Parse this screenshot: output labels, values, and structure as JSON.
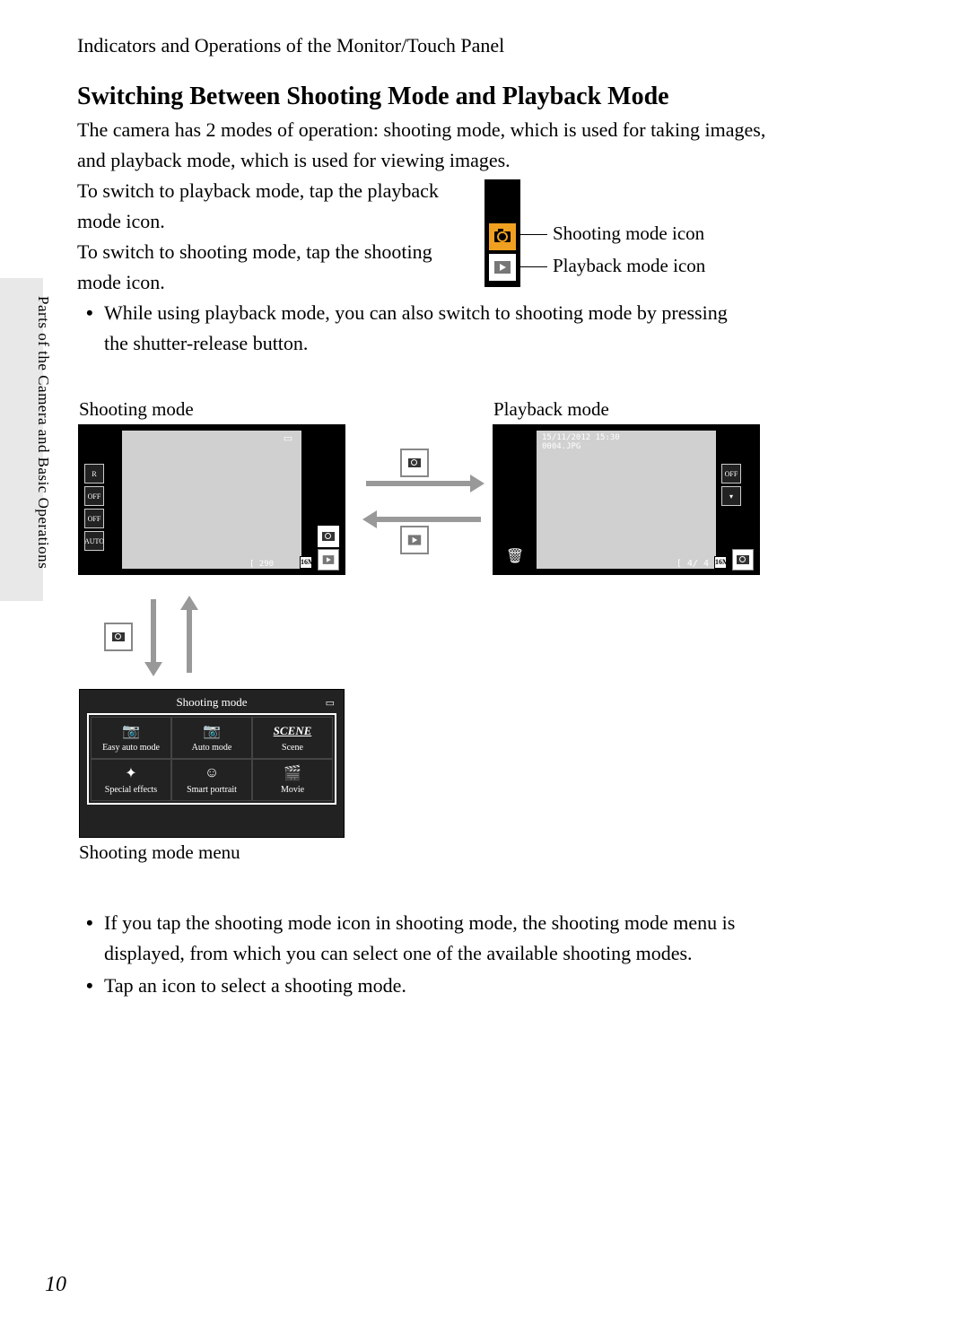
{
  "header": "Indicators and Operations of the Monitor/Touch Panel",
  "side_label": "Parts of the Camera and Basic Operations",
  "title": "Switching Between Shooting Mode and Playback Mode",
  "para1": "The camera has 2 modes of operation: shooting mode, which is used for taking images, and playback mode, which is used for viewing images.",
  "para2": "To switch to playback mode, tap the playback mode icon.",
  "para3": "To switch to shooting mode, tap the shooting mode icon.",
  "bullet1": "While using playback mode, you can also switch to shooting mode by pressing the shutter-release button.",
  "callout": {
    "shooting": "Shooting mode icon",
    "playback": "Playback mode icon"
  },
  "labels": {
    "shooting_mode": "Shooting mode",
    "playback_mode": "Playback mode",
    "menu_caption": "Shooting mode menu"
  },
  "shoot_screen": {
    "remaining": "[  290",
    "badge": "16M",
    "side_icons": [
      "R",
      "OFF",
      "OFF",
      "AUTO"
    ]
  },
  "play_screen": {
    "timestamp": "15/11/2012 15:30",
    "filename": "0004.JPG",
    "counter": "[     4/     4",
    "badge": "16M",
    "side_icons": [
      "OFF",
      "▾"
    ]
  },
  "menu": {
    "title": "Shooting mode",
    "items": [
      {
        "label": "Easy auto mode",
        "icon": "📷"
      },
      {
        "label": "Auto mode",
        "icon": "📷"
      },
      {
        "label": "Scene",
        "icon": "SCENE"
      },
      {
        "label": "Special effects",
        "icon": "✦"
      },
      {
        "label": "Smart portrait",
        "icon": "☺"
      },
      {
        "label": "Movie",
        "icon": "🎬"
      }
    ]
  },
  "bullet2": "If you tap the shooting mode icon in shooting mode, the shooting mode menu is displayed, from which you can select one of the available shooting modes.",
  "bullet3": "Tap an icon to select a shooting mode.",
  "page_number": "10"
}
